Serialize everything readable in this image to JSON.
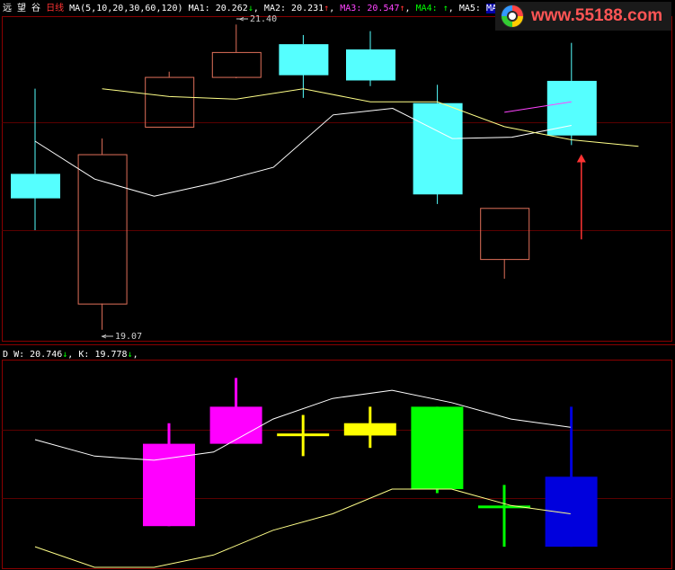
{
  "colors": {
    "background": "#000000",
    "frame": "#8a0000",
    "grid": "#5a0000",
    "up_candle": "#e0705a",
    "down_candle": "#55ffff",
    "ma1": "#ffffff",
    "ma2": "#ffff88",
    "ma3": "#ff44ff",
    "arrow": "#ff3333",
    "upper_band": "#ffffff",
    "lower_band": "#ffff88",
    "magenta": "#ff00ff",
    "yellow": "#ffff00",
    "green": "#00ff00",
    "blue": "#0000dd",
    "header_text": "#ffffff",
    "title_red": "#ff3333",
    "watermark": "#ff5555"
  },
  "header": {
    "app_title": "远 望 谷",
    "period": "日线",
    "ma_params": "MA(5,10,20,30,60,120)",
    "ma1_label": "MA1:",
    "ma1_value": "20.262",
    "ma1_arrow": "↓",
    "ma2_label": "MA2:",
    "ma2_value": "20.231",
    "ma2_arrow": "↑",
    "ma3_label": "MA3:",
    "ma3_value": "20.547",
    "ma3_arrow": "↑",
    "ma4_label": "MA4:",
    "ma4_arrow": "↑",
    "ma5_label": "MA5:",
    "ma6_label": "MA6"
  },
  "watermark": {
    "url": "www.55188.com"
  },
  "sub_header": {
    "prefix": "D",
    "w_label": "W:",
    "w_value": "20.746",
    "w_arrow": "↓",
    "k_label": "K:",
    "k_value": "19.778",
    "k_arrow": "↓"
  },
  "annotations": {
    "high_label": "21.40",
    "low_label": "19.07"
  },
  "chart_data": [
    {
      "type": "candlestick",
      "title": "远望谷 日线",
      "ylim": [
        19.0,
        21.45
      ],
      "candles": [
        {
          "open": 20.26,
          "close": 20.08,
          "high": 20.91,
          "low": 19.83
        },
        {
          "open": 19.27,
          "close": 20.41,
          "high": 20.53,
          "low": 19.07
        },
        {
          "open": 20.62,
          "close": 21.0,
          "high": 21.04,
          "low": 20.62
        },
        {
          "open": 21.0,
          "close": 21.19,
          "high": 21.4,
          "low": 20.99
        },
        {
          "open": 21.25,
          "close": 21.02,
          "high": 21.32,
          "low": 20.84
        },
        {
          "open": 21.21,
          "close": 20.98,
          "high": 21.35,
          "low": 20.93
        },
        {
          "open": 20.8,
          "close": 20.11,
          "high": 20.94,
          "low": 20.03
        },
        {
          "open": 19.61,
          "close": 20.0,
          "high": 20.0,
          "low": 19.46
        },
        {
          "open": 20.97,
          "close": 20.56,
          "high": 21.26,
          "low": 20.48
        }
      ],
      "series": [
        {
          "name": "MA1",
          "values": [
            20.51,
            20.22,
            20.09,
            20.19,
            20.31,
            20.71,
            20.76,
            20.53,
            20.54,
            20.63
          ]
        },
        {
          "name": "MA2",
          "values": [
            20.91,
            20.85,
            20.83,
            20.91,
            20.81,
            20.81,
            20.62,
            20.52,
            20.47
          ]
        },
        {
          "name": "MA3",
          "values": [
            20.73,
            20.81
          ]
        }
      ],
      "arrow": {
        "index": 8,
        "top": 20.41,
        "bottom": 19.76
      }
    },
    {
      "type": "candlestick",
      "title": "W / K",
      "ylim": [
        18.0,
        23.0
      ],
      "candles": [
        {
          "open": 19.0,
          "close": 21.0,
          "high": 21.5,
          "low": 19.0,
          "color": "magenta"
        },
        {
          "open": 21.0,
          "close": 21.9,
          "high": 22.6,
          "low": 21.0,
          "color": "magenta"
        },
        {
          "open": 21.25,
          "close": 21.25,
          "high": 21.7,
          "low": 20.7,
          "color": "yellow"
        },
        {
          "open": 21.5,
          "close": 21.2,
          "high": 21.9,
          "low": 20.9,
          "color": "yellow"
        },
        {
          "open": 21.9,
          "close": 19.9,
          "high": 21.9,
          "low": 19.8,
          "color": "green"
        },
        {
          "open": 19.5,
          "close": 19.5,
          "high": 20.0,
          "low": 18.5,
          "color": "green"
        },
        {
          "open": 20.2,
          "close": 18.5,
          "high": 21.9,
          "low": 18.5,
          "color": "blue"
        }
      ],
      "series": [
        {
          "name": "W",
          "values": [
            21.1,
            20.7,
            20.6,
            20.8,
            21.6,
            22.1,
            22.3,
            22.0,
            21.6,
            21.4
          ]
        },
        {
          "name": "K",
          "values": [
            18.5,
            18.0,
            18.0,
            18.3,
            18.9,
            19.3,
            19.9,
            19.9,
            19.5,
            19.3
          ]
        }
      ]
    }
  ]
}
